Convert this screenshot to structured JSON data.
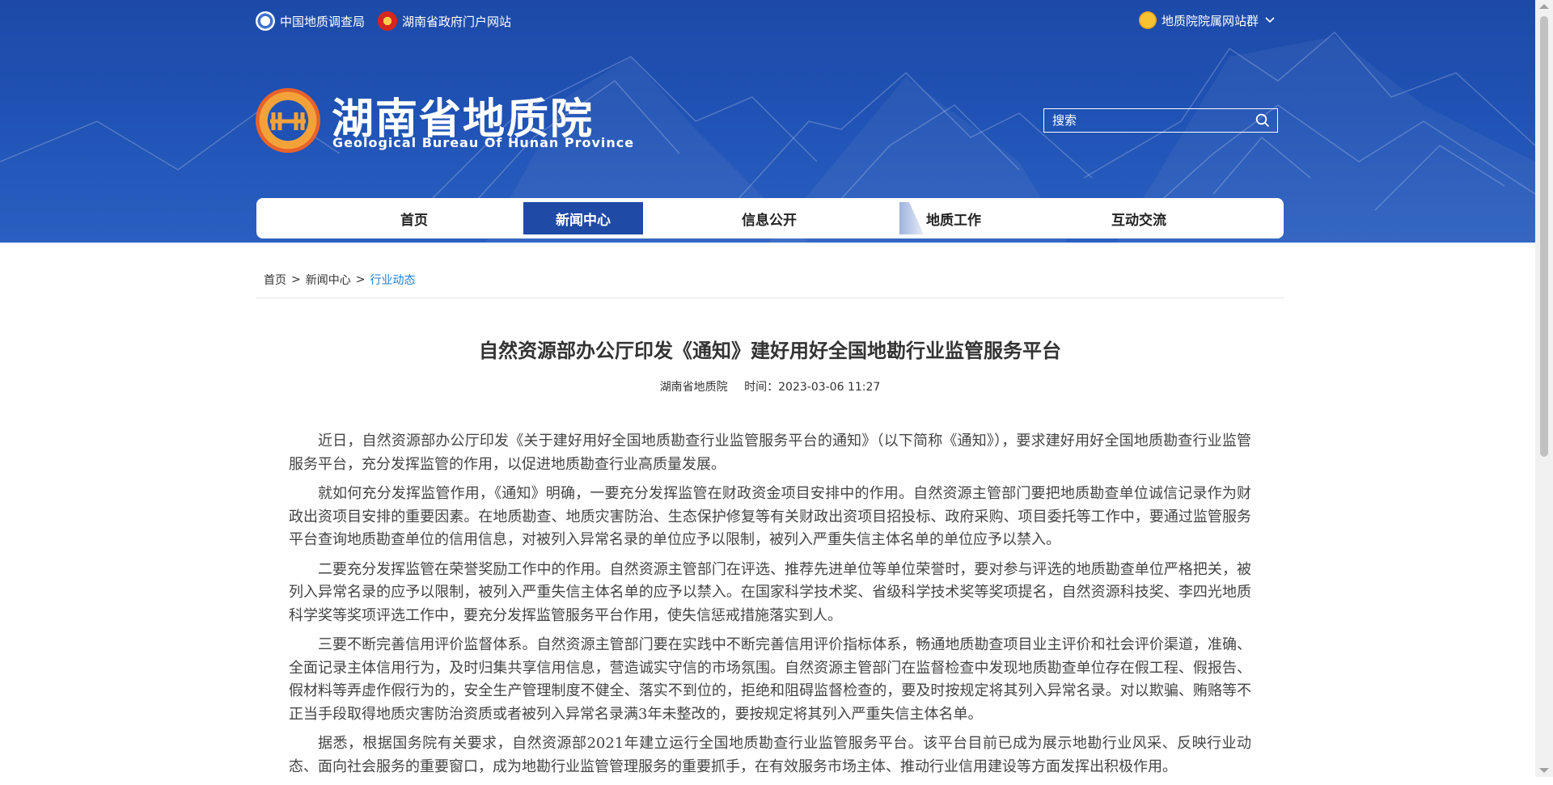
{
  "topbar": {
    "link1": "中国地质调查局",
    "link2": "湖南省政府门户网站",
    "sites": "地质院院属网站群"
  },
  "logo": {
    "title": "湖南省地质院",
    "subtitle": "Geological Bureau Of Hunan Province"
  },
  "search": {
    "placeholder": "搜索"
  },
  "nav": {
    "items": [
      "首页",
      "新闻中心",
      "信息公开",
      "地质工作",
      "互动交流"
    ],
    "active": "新闻中心"
  },
  "breadcrumb": {
    "home": "首页",
    "sep1": ">",
    "news": "新闻中心",
    "sep2": ">",
    "current": "行业动态"
  },
  "article": {
    "title": "自然资源部办公厅印发《通知》建好用好全国地勘行业监管服务平台",
    "source": "湖南省地质院",
    "time": "时间：2023-03-06 11:27",
    "paragraphs": [
      "近日，自然资源部办公厅印发《关于建好用好全国地质勘查行业监管服务平台的通知》（以下简称《通知》），要求建好用好全国地质勘查行业监管服务平台，充分发挥监管的作用，以促进地质勘查行业高质量发展。",
      "就如何充分发挥监管作用，《通知》明确，一要充分发挥监管在财政资金项目安排中的作用。自然资源主管部门要把地质勘查单位诚信记录作为财政出资项目安排的重要因素。在地质勘查、地质灾害防治、生态保护修复等有关财政出资项目招投标、政府采购、项目委托等工作中，要通过监管服务平台查询地质勘查单位的信用信息，对被列入异常名录的单位应予以限制，被列入严重失信主体名单的单位应予以禁入。",
      "二要充分发挥监管在荣誉奖励工作中的作用。自然资源主管部门在评选、推荐先进单位等单位荣誉时，要对参与评选的地质勘查单位严格把关，被列入异常名录的应予以限制，被列入严重失信主体名单的应予以禁入。在国家科学技术奖、省级科学技术奖等奖项提名，自然资源科技奖、李四光地质科学奖等奖项评选工作中，要充分发挥监管服务平台作用，使失信惩戒措施落实到人。",
      "三要不断完善信用评价监督体系。自然资源主管部门要在实践中不断完善信用评价指标体系，畅通地质勘查项目业主评价和社会评价渠道，准确、全面记录主体信用行为，及时归集共享信用信息，营造诚实守信的市场氛围。自然资源主管部门在监督检查中发现地质勘查单位存在假工程、假报告、假材料等弄虚作假行为的，安全生产管理制度不健全、落实不到位的，拒绝和阻碍监督检查的，要及时按规定将其列入异常名录。对以欺骗、贿赂等不正当手段取得地质灾害防治资质或者被列入异常名录满3年未整改的，要按规定将其列入严重失信主体名单。",
      "据悉，根据国务院有关要求，自然资源部2021年建立运行全国地质勘查行业监管服务平台。该平台目前已成为展示地勘行业风采、反映行业动态、面向社会服务的重要窗口，成为地勘行业监管管理服务的重要抓手，在有效服务市场主体、推动行业信用建设等方面发挥出积极作用。"
    ]
  },
  "colors": {
    "header_blue": "#1f52b4",
    "nav_active": "#1f4aa6",
    "breadcrumb_current": "#1d7fd1"
  }
}
